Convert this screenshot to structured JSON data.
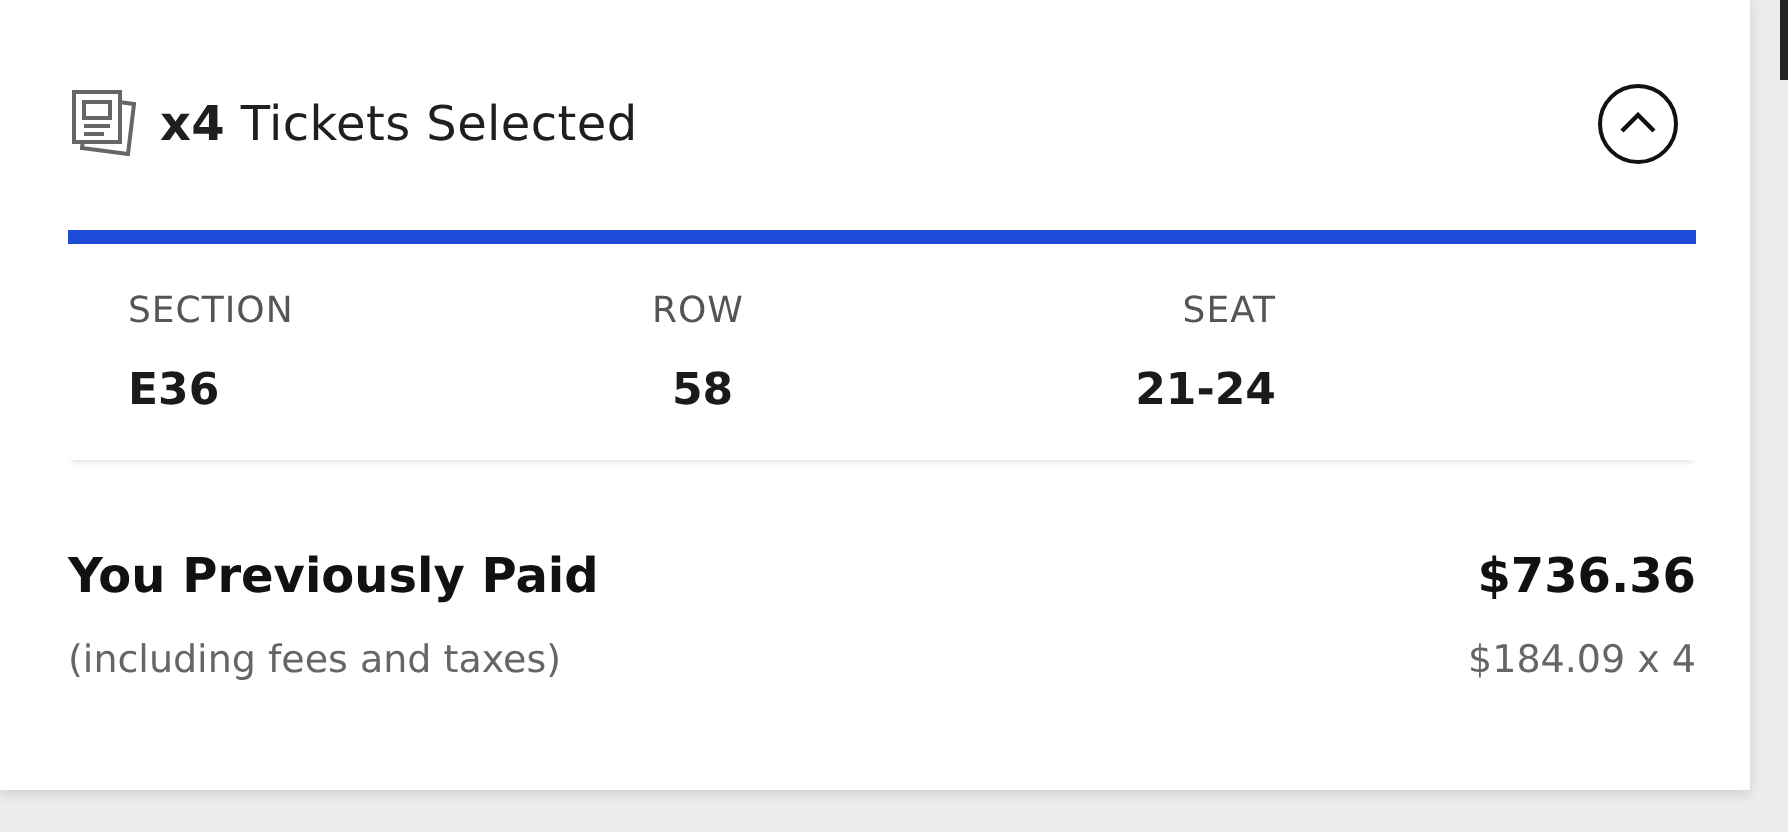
{
  "header": {
    "title": "**x4** Tickets Selected",
    "expanded": true
  },
  "seat_info": [
    {
      "label": "SECTION",
      "value": "E36"
    },
    {
      "label": "ROW",
      "value": "58"
    },
    {
      "label": "SEAT",
      "value": "21-24"
    }
  ],
  "payment": {
    "title": "You Previously Paid",
    "total": "$736.36",
    "note": "(including fees and taxes)",
    "breakdown": "$184.09 x 4"
  }
}
